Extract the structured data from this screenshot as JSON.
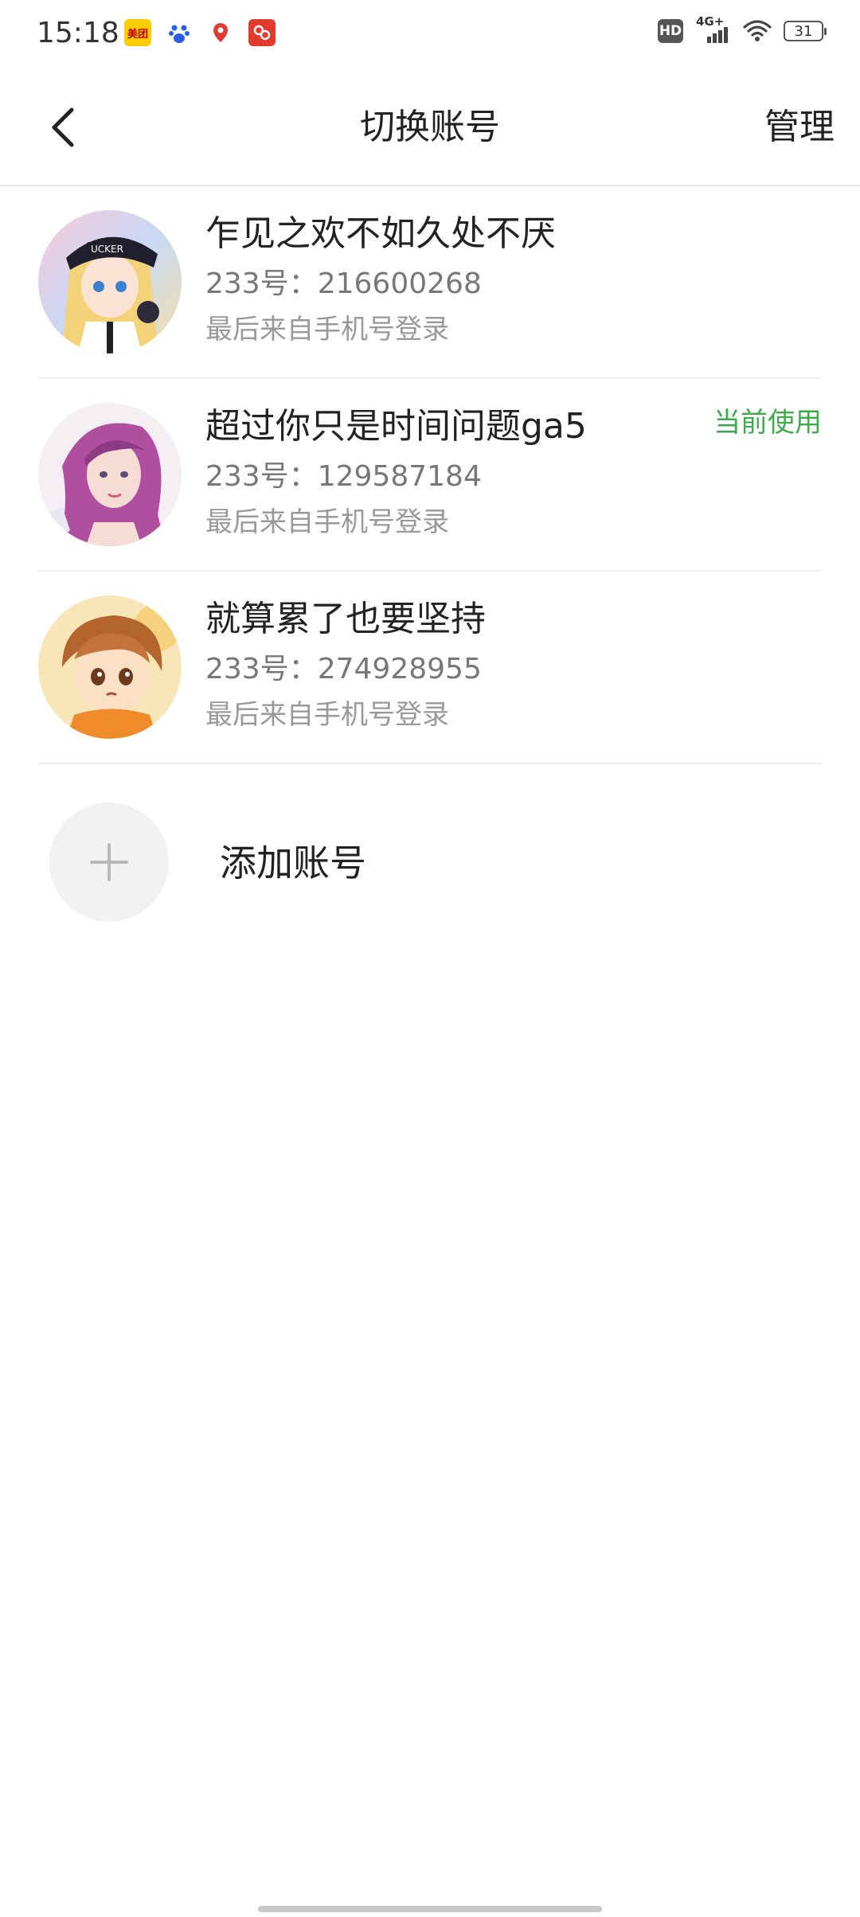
{
  "status_bar": {
    "time": "15:18",
    "apps": [
      {
        "icon": "meituan-app-icon",
        "label": "美团",
        "color": "#ffcc00",
        "text_color": "#c00000"
      },
      {
        "icon": "baidu-app-icon",
        "label": "",
        "color": "#ffffff",
        "text_color": "#2a5ee8"
      },
      {
        "icon": "map-pin-app-icon",
        "label": "",
        "color": "#ffffff",
        "text_color": "#e23b2e"
      },
      {
        "icon": "red-app-icon",
        "label": "",
        "color": "#e23b2e",
        "text_color": "#ffffff"
      }
    ],
    "hd": "HD",
    "network": "4G+",
    "battery": "31"
  },
  "header": {
    "title": "切换账号",
    "manage_label": "管理"
  },
  "accounts": [
    {
      "name": "乍见之欢不如久处不厌",
      "id_text": "233号：216600268",
      "login_text": "最后来自手机号登录",
      "current": "",
      "avatar": "avatar-anime-girl-cap"
    },
    {
      "name": "超过你只是时间问题ga5",
      "id_text": "233号：129587184",
      "login_text": "最后来自手机号登录",
      "current": "当前使用",
      "avatar": "avatar-pink-hair-girl"
    },
    {
      "name": "就算累了也要坚持",
      "id_text": "233号：274928955",
      "login_text": "最后来自手机号登录",
      "current": "",
      "avatar": "avatar-anime-boy"
    }
  ],
  "add_account": {
    "label": "添加账号"
  },
  "colors": {
    "accent_green": "#3eaa4c",
    "divider": "#ececec"
  }
}
